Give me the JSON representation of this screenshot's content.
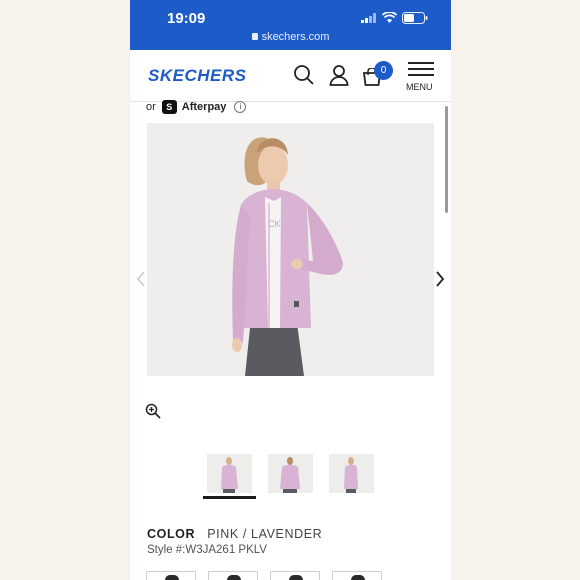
{
  "status_bar": {
    "time": "19:09",
    "url": "skechers.com"
  },
  "header": {
    "logo": "SKECHERS",
    "cart_count": "0",
    "menu_label": "MENU"
  },
  "afterpay": {
    "prefix": "or",
    "logo_glyph": "S",
    "name": "Afterpay",
    "info": "i"
  },
  "product": {
    "color_label": "COLOR",
    "color_value": "PINK / LAVENDER",
    "style_text": "Style #:W3JA261 PKLV",
    "shirt_print": "CK"
  },
  "colors": {
    "brand_blue": "#1d5cc8",
    "jacket": "#d9b3d3",
    "leggings": "#5a5a60"
  },
  "icons": [
    "search-icon",
    "user-icon",
    "cart-icon",
    "hamburger-icon",
    "zoom-in-icon",
    "chevron-left-icon",
    "chevron-right-icon",
    "lock-icon"
  ]
}
